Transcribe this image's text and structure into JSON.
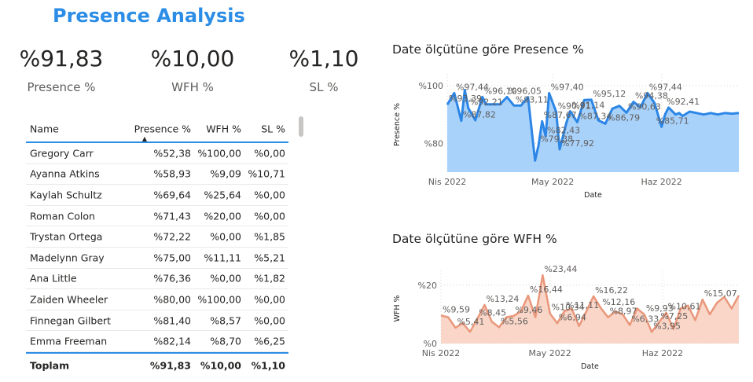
{
  "title": "Presence Analysis",
  "kpis": [
    {
      "value": "%91,83",
      "label": "Presence %"
    },
    {
      "value": "%10,00",
      "label": "WFH %"
    },
    {
      "value": "%1,10",
      "label": "SL %"
    }
  ],
  "table": {
    "headers": [
      "Name",
      "Presence %",
      "WFH %",
      "SL %"
    ],
    "rows": [
      [
        "Gregory Carr",
        "%52,38",
        "%100,00",
        "%0,00"
      ],
      [
        "Ayanna Atkins",
        "%58,93",
        "%9,09",
        "%10,71"
      ],
      [
        "Kaylah Schultz",
        "%69,64",
        "%25,64",
        "%0,00"
      ],
      [
        "Roman Colon",
        "%71,43",
        "%20,00",
        "%0,00"
      ],
      [
        "Trystan Ortega",
        "%72,22",
        "%0,00",
        "%1,85"
      ],
      [
        "Madelynn Gray",
        "%75,00",
        "%11,11",
        "%5,21"
      ],
      [
        "Ana Little",
        "%76,36",
        "%0,00",
        "%1,82"
      ],
      [
        "Zaiden Wheeler",
        "%80,00",
        "%100,00",
        "%0,00"
      ],
      [
        "Finnegan Gilbert",
        "%81,40",
        "%8,57",
        "%0,00"
      ],
      [
        "Emma Freeman",
        "%82,14",
        "%8,70",
        "%6,25"
      ]
    ],
    "total": [
      "Toplam",
      "%91,83",
      "%10,00",
      "%1,10"
    ]
  },
  "chart_data": [
    {
      "type": "area",
      "title": "Date ölçütüne göre Presence %",
      "xlabel": "Date",
      "ylabel": "Presence %",
      "x_tick_labels": [
        "Nis 2022",
        "May 2022",
        "Haz 2022"
      ],
      "y_tick_labels": [
        "%100",
        "%80"
      ],
      "y_ticks": [
        100,
        80
      ],
      "ylim": [
        70,
        103
      ],
      "color": "#2c86e6",
      "fill": "#a9d2fb",
      "grid": true,
      "x_dates": [
        "2022-04-01",
        "2022-04-03",
        "2022-04-05",
        "2022-04-06",
        "2022-04-07",
        "2022-04-09",
        "2022-04-11",
        "2022-04-12",
        "2022-04-14",
        "2022-04-16",
        "2022-04-18",
        "2022-04-20",
        "2022-04-22",
        "2022-04-24",
        "2022-04-26",
        "2022-04-27",
        "2022-04-28",
        "2022-04-29",
        "2022-04-30",
        "2022-05-02",
        "2022-05-03",
        "2022-05-05",
        "2022-05-06",
        "2022-05-08",
        "2022-05-10",
        "2022-05-12",
        "2022-05-14",
        "2022-05-16",
        "2022-05-18",
        "2022-05-20",
        "2022-05-22",
        "2022-05-24",
        "2022-05-26",
        "2022-05-28",
        "2022-05-30",
        "2022-06-01",
        "2022-06-02",
        "2022-06-03",
        "2022-06-05",
        "2022-06-06",
        "2022-06-07",
        "2022-06-09",
        "2022-06-11",
        "2022-06-13",
        "2022-06-15",
        "2022-06-17",
        "2022-06-19",
        "2022-06-21",
        "2022-06-23"
      ],
      "values": [
        93.39,
        97.44,
        87.82,
        98.5,
        92.21,
        88.0,
        96.1,
        93.5,
        93.5,
        93.5,
        96.05,
        93.11,
        93.11,
        96.0,
        74.0,
        79.38,
        87.67,
        82.43,
        97.4,
        90.91,
        77.92,
        87.5,
        91.14,
        87.34,
        95.0,
        95.12,
        88.0,
        86.79,
        92.0,
        93.0,
        90.63,
        94.38,
        92.5,
        97.44,
        94.0,
        85.71,
        90.0,
        92.41,
        90.0,
        90.5,
        89.5,
        91.0,
        90.5,
        90.0,
        90.5,
        90.0,
        90.5,
        90.3,
        90.5
      ],
      "data_labels": [
        {
          "x": "2022-04-01",
          "y": 93.39,
          "text": "%93,39"
        },
        {
          "x": "2022-04-03",
          "y": 97.44,
          "text": "%97,44"
        },
        {
          "x": "2022-04-05",
          "y": 87.82,
          "text": "%87,82"
        },
        {
          "x": "2022-04-07",
          "y": 92.21,
          "text": "%92,21"
        },
        {
          "x": "2022-04-11",
          "y": 96.1,
          "text": "%96,10"
        },
        {
          "x": "2022-04-18",
          "y": 96.05,
          "text": "%96,05"
        },
        {
          "x": "2022-04-20",
          "y": 93.11,
          "text": "%93,11"
        },
        {
          "x": "2022-04-27",
          "y": 79.38,
          "text": "%79,38"
        },
        {
          "x": "2022-04-28",
          "y": 87.67,
          "text": "%87,67"
        },
        {
          "x": "2022-04-29",
          "y": 82.43,
          "text": "%82,43"
        },
        {
          "x": "2022-04-30",
          "y": 97.4,
          "text": "%97,40"
        },
        {
          "x": "2022-05-02",
          "y": 90.91,
          "text": "%90,91"
        },
        {
          "x": "2022-05-03",
          "y": 77.92,
          "text": "%77,92"
        },
        {
          "x": "2022-05-06",
          "y": 91.14,
          "text": "%91,14"
        },
        {
          "x": "2022-05-08",
          "y": 87.34,
          "text": "%87,34"
        },
        {
          "x": "2022-05-12",
          "y": 95.12,
          "text": "%95,12"
        },
        {
          "x": "2022-05-16",
          "y": 86.79,
          "text": "%86,79"
        },
        {
          "x": "2022-05-22",
          "y": 90.63,
          "text": "%90,63"
        },
        {
          "x": "2022-05-24",
          "y": 94.38,
          "text": "%94,38"
        },
        {
          "x": "2022-05-28",
          "y": 97.44,
          "text": "%97,44"
        },
        {
          "x": "2022-05-30",
          "y": 85.71,
          "text": "%85,71"
        },
        {
          "x": "2022-06-02",
          "y": 92.41,
          "text": "%92,41"
        }
      ]
    },
    {
      "type": "area",
      "title": "Date ölçütüne göre WFH %",
      "xlabel": "Date",
      "ylabel": "WFH %",
      "x_tick_labels": [
        "Nis 2022",
        "May 2022",
        "Haz 2022"
      ],
      "y_tick_labels": [
        "%20",
        "%0"
      ],
      "y_ticks": [
        20,
        0
      ],
      "ylim": [
        0,
        24
      ],
      "color": "#e9977a",
      "fill": "#f9d6c8",
      "grid": true,
      "x_dates": [
        "2022-04-01",
        "2022-04-03",
        "2022-04-05",
        "2022-04-07",
        "2022-04-09",
        "2022-04-11",
        "2022-04-13",
        "2022-04-15",
        "2022-04-17",
        "2022-04-19",
        "2022-04-21",
        "2022-04-23",
        "2022-04-25",
        "2022-04-27",
        "2022-04-29",
        "2022-05-01",
        "2022-05-03",
        "2022-05-05",
        "2022-05-07",
        "2022-05-09",
        "2022-05-11",
        "2022-05-13",
        "2022-05-15",
        "2022-05-17",
        "2022-05-19",
        "2022-05-21",
        "2022-05-23",
        "2022-05-25",
        "2022-05-27",
        "2022-05-29",
        "2022-05-31",
        "2022-06-02",
        "2022-06-04",
        "2022-06-06",
        "2022-06-08",
        "2022-06-10",
        "2022-06-12",
        "2022-06-14",
        "2022-06-16",
        "2022-06-18",
        "2022-06-20",
        "2022-06-22"
      ],
      "values": [
        9.59,
        9.0,
        5.41,
        7.0,
        4.0,
        8.45,
        13.24,
        7.5,
        5.56,
        9.0,
        9.46,
        11.0,
        16.44,
        9.0,
        23.44,
        10.34,
        6.94,
        11.11,
        12.0,
        6.0,
        11.0,
        16.22,
        12.16,
        8.97,
        11.0,
        10.0,
        6.33,
        12.0,
        9.93,
        3.95,
        7.25,
        10.61,
        5.0,
        12.0,
        13.0,
        8.0,
        15.07,
        10.0,
        14.0,
        16.0,
        12.0,
        16.5
      ],
      "data_labels": [
        {
          "x": "2022-04-01",
          "y": 9.59,
          "text": "%9,59"
        },
        {
          "x": "2022-04-05",
          "y": 5.41,
          "text": "%5,41"
        },
        {
          "x": "2022-04-11",
          "y": 8.45,
          "text": "%8,45"
        },
        {
          "x": "2022-04-13",
          "y": 13.24,
          "text": "%13,24"
        },
        {
          "x": "2022-04-17",
          "y": 5.56,
          "text": "%5,56"
        },
        {
          "x": "2022-04-21",
          "y": 9.46,
          "text": "%9,46"
        },
        {
          "x": "2022-04-25",
          "y": 16.44,
          "text": "%16,44"
        },
        {
          "x": "2022-04-29",
          "y": 23.44,
          "text": "%23,44"
        },
        {
          "x": "2022-05-01",
          "y": 10.34,
          "text": "%10,34"
        },
        {
          "x": "2022-05-03",
          "y": 6.94,
          "text": "%6,94"
        },
        {
          "x": "2022-05-05",
          "y": 11.11,
          "text": "%11,11"
        },
        {
          "x": "2022-05-13",
          "y": 16.22,
          "text": "%16,22"
        },
        {
          "x": "2022-05-15",
          "y": 12.16,
          "text": "%12,16"
        },
        {
          "x": "2022-05-17",
          "y": 8.97,
          "text": "%8,97"
        },
        {
          "x": "2022-05-23",
          "y": 6.33,
          "text": "%6,33"
        },
        {
          "x": "2022-05-27",
          "y": 9.93,
          "text": "%9,93"
        },
        {
          "x": "2022-05-29",
          "y": 3.95,
          "text": "%3,95"
        },
        {
          "x": "2022-05-31",
          "y": 7.25,
          "text": "%7,25"
        },
        {
          "x": "2022-06-02",
          "y": 10.61,
          "text": "%10,61"
        },
        {
          "x": "2022-06-12",
          "y": 15.07,
          "text": "%15,07"
        }
      ]
    }
  ]
}
